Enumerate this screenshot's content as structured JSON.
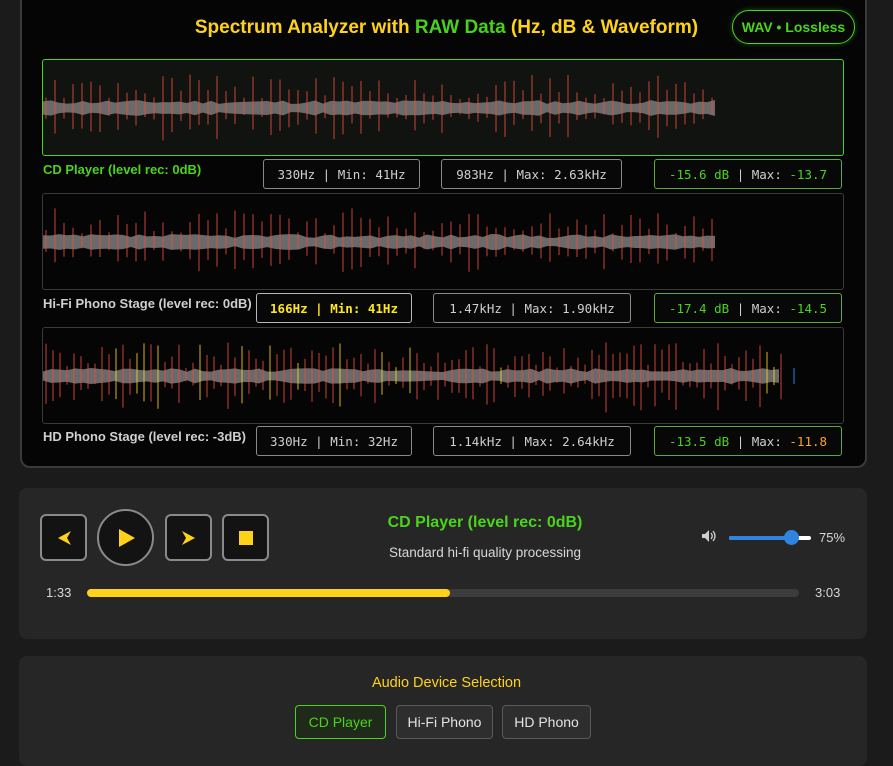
{
  "header": {
    "title_part1": "Spectrum Analyzer with ",
    "title_raw": "RAW Data",
    "title_part2": " (Hz, dB & Waveform)",
    "format_badge": "WAV • Lossless"
  },
  "tracks": [
    {
      "label": "CD Player (level rec: 0dB)",
      "low_stat": "330Hz | Min: 41Hz",
      "mid_stat": "983Hz | Max: 2.63kHz",
      "db_value": "-15.6 dB",
      "db_sep": " | Max: ",
      "db_max": "-13.7",
      "active": true
    },
    {
      "label": "Hi-Fi Phono Stage (level rec: 0dB)",
      "low_stat": "166Hz | Min: 41Hz",
      "mid_stat": "1.47kHz | Max: 1.90kHz",
      "db_value": "-17.4 dB",
      "db_sep": " | Max: ",
      "db_max": "-14.5",
      "active": false
    },
    {
      "label": "HD Phono Stage (level rec: -3dB)",
      "low_stat": "330Hz | Min: 32Hz",
      "mid_stat": "1.14kHz | Max: 2.64kHz",
      "db_value": "-13.5 dB",
      "db_sep": " | Max: ",
      "db_max": "-11.8",
      "active": false
    }
  ],
  "player": {
    "now_playing": "CD Player (level rec: 0dB)",
    "description": "Standard hi-fi quality processing",
    "elapsed": "1:33",
    "duration": "3:03",
    "progress": 0.51,
    "volume_label": "75%",
    "volume": 0.75,
    "icons": [
      "prev-icon",
      "play-icon",
      "next-icon",
      "stop-icon",
      "speaker-icon"
    ]
  },
  "device_selection": {
    "heading": "Audio Device Selection",
    "options": [
      "CD Player",
      "Hi-Fi Phono",
      "HD Phono"
    ],
    "selected": "CD Player"
  },
  "colors": {
    "accent_green": "#4ad41c",
    "accent_yellow": "#ffd21a",
    "accent_orange": "#ffa030",
    "volume_blue": "#2f84e0",
    "spike_red": "#e8503a"
  }
}
